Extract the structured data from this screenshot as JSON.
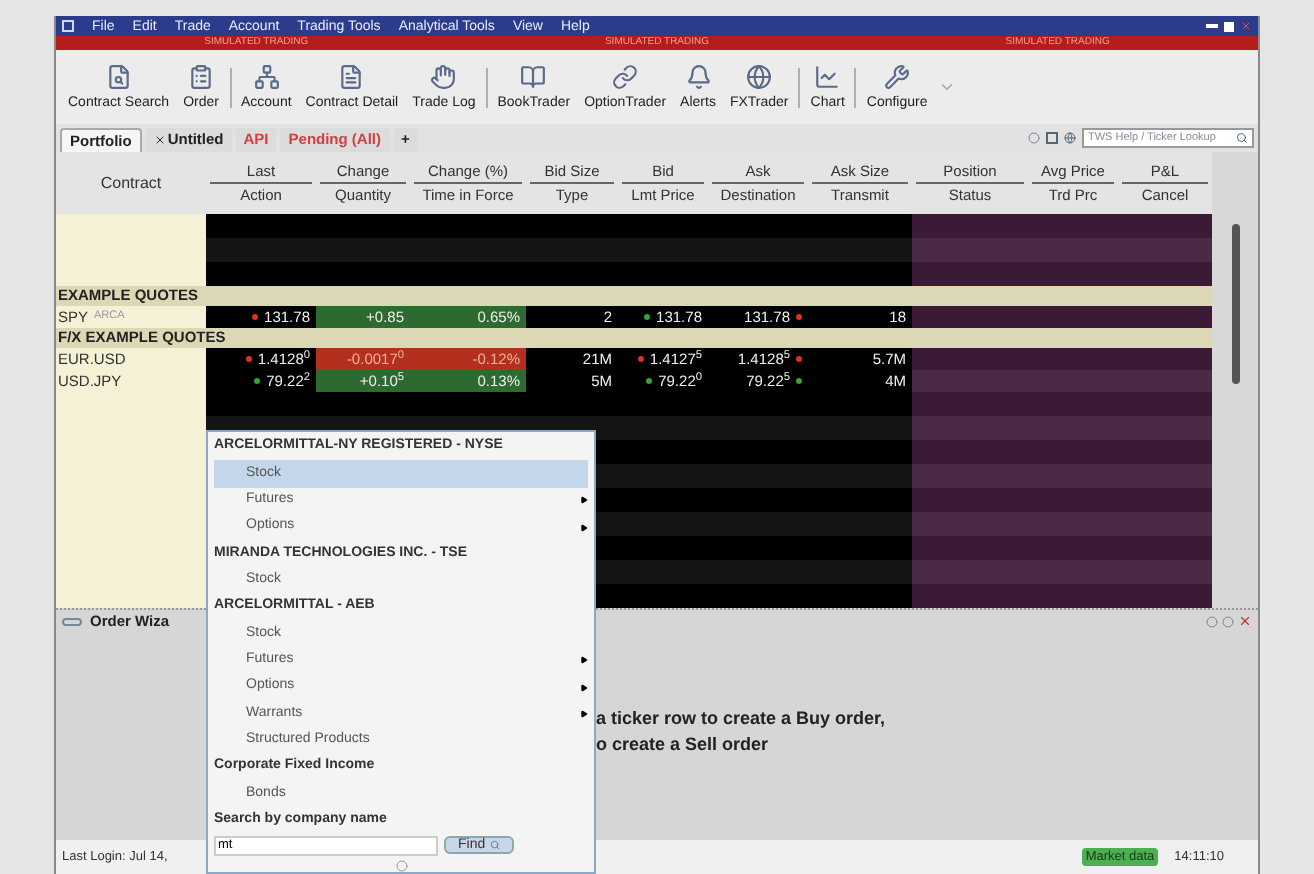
{
  "menu": [
    {
      "label": "File"
    },
    {
      "label": "Edit"
    },
    {
      "label": "Trade"
    },
    {
      "label": "Account"
    },
    {
      "label": "Trading Tools"
    },
    {
      "label": "Analytical Tools"
    },
    {
      "label": "View"
    },
    {
      "label": "Help"
    }
  ],
  "banner": [
    "SIMULATED TRADING",
    "SIMULATED TRADING",
    "SIMULATED TRADING"
  ],
  "toolbar_groups": [
    {
      "buttons": [
        "Contract Search",
        "Order"
      ]
    },
    {
      "buttons": [
        "Account",
        "Contract Detail",
        "Trade Log"
      ]
    },
    {
      "buttons": [
        "BookTrader",
        "OptionTrader",
        "Alerts",
        "FXTrader"
      ]
    },
    {
      "buttons": [
        "Chart"
      ]
    },
    {
      "buttons": [
        "Configure"
      ]
    }
  ],
  "tabs": [
    {
      "label": "Portfolio",
      "selected": true,
      "closable": false,
      "alert": false
    },
    {
      "label": "Untitled",
      "selected": false,
      "closable": true,
      "alert": false
    },
    {
      "label": "API",
      "selected": false,
      "closable": false,
      "alert": true
    },
    {
      "label": "Pending (All)",
      "selected": false,
      "closable": false,
      "alert": true
    },
    {
      "label": "+",
      "selected": false,
      "closable": false,
      "alert": false
    }
  ],
  "search": {
    "placeholder": "TWS Help / Ticker Lookup"
  },
  "contract_column": "Contract",
  "market_columns": [
    {
      "top": "Last",
      "bottom": "Action"
    },
    {
      "top": "Change",
      "bottom": "Quantity"
    },
    {
      "top": "Change (%)",
      "bottom": "Time in Force"
    },
    {
      "top": "Bid Size",
      "bottom": "Type"
    },
    {
      "top": "Bid",
      "bottom": "Lmt Price"
    },
    {
      "top": "Ask",
      "bottom": "Destination"
    },
    {
      "top": "Ask Size",
      "bottom": "Transmit"
    }
  ],
  "portfolio_columns": [
    {
      "top": "Position",
      "bottom": "Status"
    },
    {
      "top": "Avg Price",
      "bottom": "Trd Prc"
    },
    {
      "top": "P&L",
      "bottom": "Cancel"
    }
  ],
  "sections": [
    {
      "title": "EXAMPLE QUOTES",
      "rows": [
        {
          "symbol": "SPY",
          "exchange": "ARCA",
          "cells": [
            {
              "text": "131.78",
              "dot_up": false
            },
            {
              "text": "+0.85",
              "gain": true
            },
            {
              "text": "0.65%",
              "gain": true
            },
            {
              "text": "2"
            },
            {
              "text": "131.78",
              "dot_up": true
            },
            {
              "text": "131.78",
              "dot_up": false
            },
            {
              "text": "18"
            }
          ]
        }
      ]
    },
    {
      "title": "F/X EXAMPLE QUOTES",
      "rows": [
        {
          "symbol": "EUR.USD",
          "cells": [
            {
              "text": "1.4128$^{0}$",
              "dot_up": false
            },
            {
              "text": "-0.0017$^{0}$",
              "gain": false
            },
            {
              "text": "-0.12%",
              "gain": false
            },
            {
              "text": "21M"
            },
            {
              "text": "1.4127$^{5}$",
              "dot_up": false
            },
            {
              "text": "1.4128$^{5}$",
              "dot_up": false
            },
            {
              "text": "5.7M"
            }
          ]
        },
        {
          "symbol": "USD.JPY",
          "cells": [
            {
              "text": "79.22$^{2}$",
              "dot_up": true
            },
            {
              "text": "+0.10$^{5}$",
              "gain": true
            },
            {
              "text": "0.13%",
              "gain": true
            },
            {
              "text": "5M"
            },
            {
              "text": "79.22$^{0}$",
              "dot_up": true
            },
            {
              "text": "79.22$^{5}$",
              "dot_up": true
            },
            {
              "text": "4M"
            }
          ]
        }
      ]
    }
  ],
  "order_wizard": {
    "title": "Order Wiza",
    "message": [
      "a ticker row to create a Buy order,",
      "o create a Sell order"
    ]
  },
  "popup": {
    "items": [
      {
        "kind": "header",
        "label": "ARCELORMITTAL-NY REGISTERED - NYSE"
      },
      {
        "kind": "item",
        "label": "Stock",
        "selected": true,
        "submenu": false
      },
      {
        "kind": "item",
        "label": "Futures",
        "selected": false,
        "submenu": true
      },
      {
        "kind": "item",
        "label": "Options",
        "selected": false,
        "submenu": true
      },
      {
        "kind": "header",
        "label": "MIRANDA TECHNOLOGIES INC. - TSE"
      },
      {
        "kind": "item",
        "label": "Stock",
        "selected": false,
        "submenu": false
      },
      {
        "kind": "header",
        "label": "ARCELORMITTAL - AEB"
      },
      {
        "kind": "item",
        "label": "Stock",
        "selected": false,
        "submenu": false
      },
      {
        "kind": "item",
        "label": "Futures",
        "selected": false,
        "submenu": true
      },
      {
        "kind": "item",
        "label": "Options",
        "selected": false,
        "submenu": true
      },
      {
        "kind": "item",
        "label": "Warrants",
        "selected": false,
        "submenu": true
      },
      {
        "kind": "item",
        "label": "Structured Products",
        "selected": false,
        "submenu": false
      },
      {
        "kind": "header",
        "label": "Corporate Fixed Income"
      },
      {
        "kind": "item",
        "label": "Bonds",
        "selected": false,
        "submenu": false
      },
      {
        "kind": "header",
        "label": "Search by company name"
      }
    ],
    "query": "mt",
    "find_button": "Find"
  },
  "status_bar": {
    "last_login": "Last Login: Jul 14,",
    "badge": "Market data",
    "time": "14:11:10"
  }
}
